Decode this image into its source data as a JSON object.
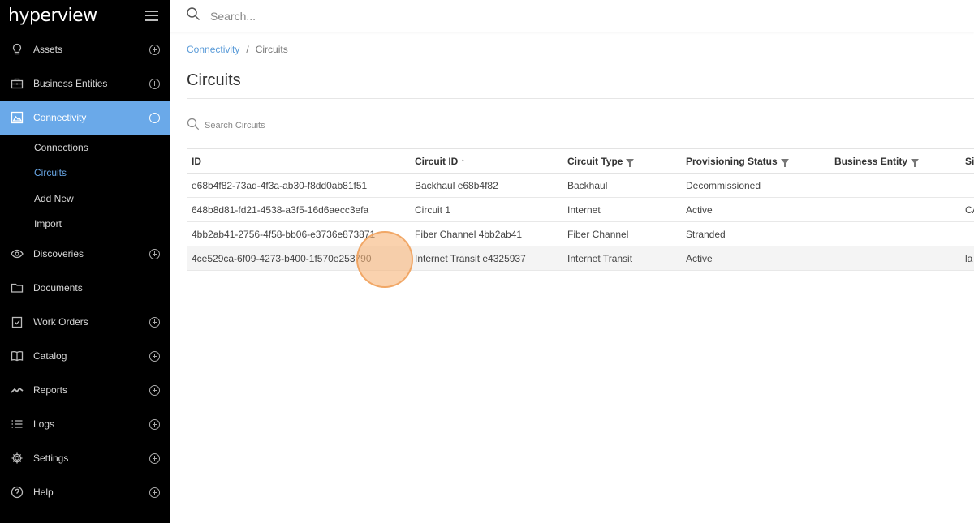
{
  "app": {
    "logo": "hyperview"
  },
  "search": {
    "placeholder": "Search..."
  },
  "sidebar": {
    "items": [
      {
        "label": "Assets",
        "icon": "lightbulb-icon"
      },
      {
        "label": "Business Entities",
        "icon": "briefcase-icon"
      },
      {
        "label": "Connectivity",
        "icon": "network-icon",
        "active": true,
        "sub": [
          {
            "label": "Connections"
          },
          {
            "label": "Circuits",
            "active": true
          },
          {
            "label": "Add New"
          },
          {
            "label": "Import"
          }
        ]
      },
      {
        "label": "Discoveries",
        "icon": "eye-icon"
      },
      {
        "label": "Documents",
        "icon": "folder-icon"
      },
      {
        "label": "Work Orders",
        "icon": "clipboard-check-icon"
      },
      {
        "label": "Catalog",
        "icon": "book-icon"
      },
      {
        "label": "Reports",
        "icon": "trend-line-icon"
      },
      {
        "label": "Logs",
        "icon": "list-icon"
      },
      {
        "label": "Settings",
        "icon": "gear-icon"
      },
      {
        "label": "Help",
        "icon": "question-icon"
      }
    ]
  },
  "breadcrumb": {
    "parent": "Connectivity",
    "separator": "/",
    "current": "Circuits"
  },
  "page": {
    "title": "Circuits",
    "search_placeholder": "Search Circuits"
  },
  "table": {
    "columns": [
      "ID",
      "Circuit ID",
      "Circuit Type",
      "Provisioning Status",
      "Business Entity",
      "Si"
    ],
    "rows": [
      [
        "e68b4f82-73ad-4f3a-ab30-f8dd0ab81f51",
        "Backhaul e68b4f82",
        "Backhaul",
        "Decommissioned",
        "",
        ""
      ],
      [
        "648b8d81-fd21-4538-a3f5-16d6aecc3efa",
        "Circuit 1",
        "Internet",
        "Active",
        "",
        "CA"
      ],
      [
        "4bb2ab41-2756-4f58-bb06-e3736e873871",
        "Fiber Channel 4bb2ab41",
        "Fiber Channel",
        "Stranded",
        "",
        ""
      ],
      [
        "4ce529ca-6f09-4273-b400-1f570e253790",
        "Internet Transit e4325937",
        "Internet Transit",
        "Active",
        "",
        "la"
      ]
    ]
  },
  "colors": {
    "accent": "#6aa9e9",
    "sidebar_bg": "#000000",
    "click_marker": "#f6b478"
  }
}
